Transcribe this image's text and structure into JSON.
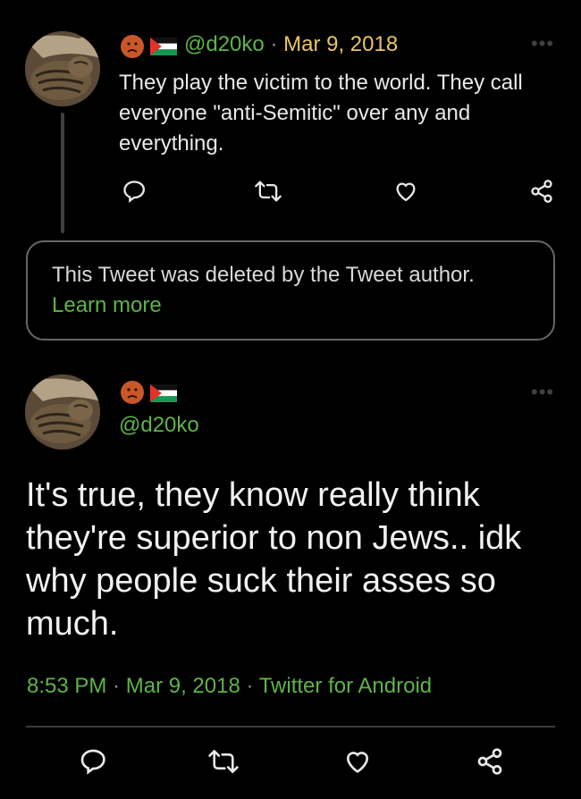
{
  "parent_tweet": {
    "handle": "@d20ko",
    "separator": "·",
    "date": "Mar 9, 2018",
    "text": "They play the victim to the world. They call everyone \"anti-Semitic\" over any and everything.",
    "more_icon": "more-dots-icon"
  },
  "deleted_notice": {
    "message": "This Tweet was deleted by the Tweet author.",
    "link": "Learn more"
  },
  "main_tweet": {
    "handle": "@d20ko",
    "text": "It's true, they know really think they're superior to non Jews.. idk why people suck their asses so much.",
    "time": "8:53 PM",
    "sep1": "·",
    "date": "Mar 9, 2018",
    "sep2": "·",
    "source": "Twitter for Android"
  },
  "icons": [
    "reply-icon",
    "retweet-icon",
    "like-icon",
    "share-icon",
    "frowning-face-icon",
    "palestine-flag-icon",
    "more-dots-icon"
  ],
  "colors": {
    "background": "#000000",
    "text": "#e7e9ea",
    "accent_green": "#5fb349",
    "date_yellow": "#e8c662",
    "icon_gray": "#e7e9ea"
  }
}
